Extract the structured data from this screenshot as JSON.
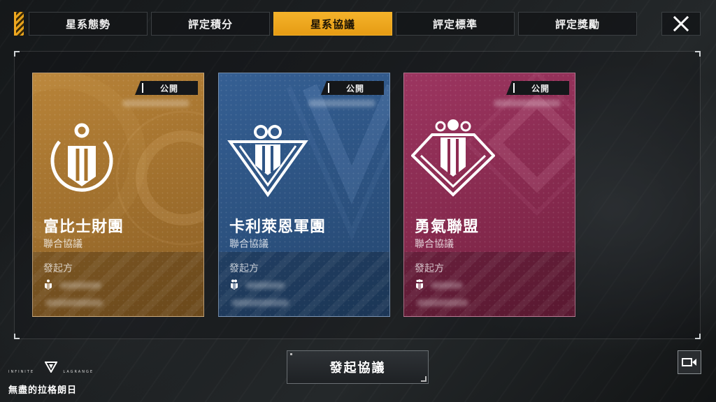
{
  "tabs": [
    {
      "label": "星系態勢",
      "active": false
    },
    {
      "label": "評定積分",
      "active": false
    },
    {
      "label": "星系協議",
      "active": true
    },
    {
      "label": "評定標準",
      "active": false
    },
    {
      "label": "評定獎勵",
      "active": false
    }
  ],
  "close_icon": "close-icon",
  "cards": [
    {
      "badge": "公開",
      "title": "富比士財團",
      "subtitle": "聯合協議",
      "initiator_label": "發起方",
      "color": "#a8742c",
      "emblem": "shield-ring-emblem"
    },
    {
      "badge": "公開",
      "title": "卡利萊恩軍團",
      "subtitle": "聯合協議",
      "initiator_label": "發起方",
      "color": "#2f5585",
      "emblem": "chevron-emblem"
    },
    {
      "badge": "公開",
      "title": "勇氣聯盟",
      "subtitle": "聯合協議",
      "initiator_label": "發起方",
      "color": "#8e2c52",
      "emblem": "diamond-emblem"
    }
  ],
  "main_button": {
    "label": "發起協議"
  },
  "record_icon": "video-camera-icon",
  "logo": {
    "small_left": "INFINITE",
    "small_right": "LAGRANGE",
    "main": "無盡的拉格朗日"
  },
  "colors": {
    "accent": "#f2a922",
    "gold_card": "#a8742c",
    "blue_card": "#2f5585",
    "magenta_card": "#8e2c52"
  }
}
